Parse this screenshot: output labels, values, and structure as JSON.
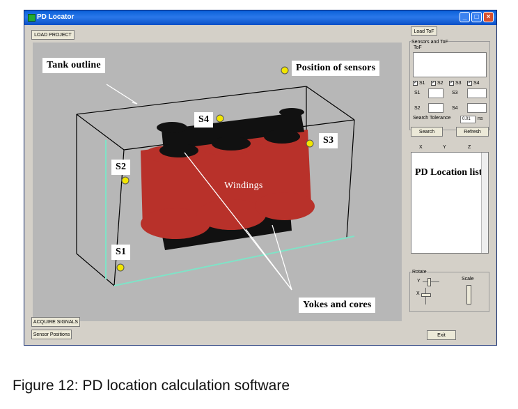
{
  "window": {
    "title": "PD Locator",
    "buttons": {
      "minimize": "_",
      "maximize": "□",
      "close": "×"
    }
  },
  "toolbar": {
    "load_project": "LOAD PROJECT"
  },
  "viewport": {
    "callouts": {
      "tank_outline": "Tank outline",
      "position_of_sensors": "Position of sensors",
      "windings": "Windings",
      "yokes_and_cores": "Yokes and cores",
      "s1": "S1",
      "s2": "S2",
      "s3": "S3",
      "s4": "S4"
    },
    "colors": {
      "background": "#b7b7b7",
      "windings": "#b8312a",
      "cores": "#111111",
      "sensor": "#f2e600",
      "tank_floor": "#7fe3c7"
    }
  },
  "bottom": {
    "acquire_signals": "ACQUIRE SIGNALS",
    "sensor_positions": "Sensor Positions",
    "exit": "Exit"
  },
  "side": {
    "load_tof": "Load ToF",
    "group_title": "Sensors and ToF",
    "tof_label": "ToF",
    "checks": [
      {
        "label": "S1",
        "checked": true
      },
      {
        "label": "S2",
        "checked": true
      },
      {
        "label": "S3",
        "checked": true
      },
      {
        "label": "S4",
        "checked": true
      }
    ],
    "field_labels": {
      "s1": "S1",
      "s2": "S2",
      "s3": "S3",
      "s4": "S4"
    },
    "search_tolerance": {
      "label": "Search Tolerance",
      "value": "0.01",
      "unit": "ns"
    },
    "search": "Search",
    "refresh": "Refresh",
    "columns": [
      "X",
      "Y",
      "Z"
    ],
    "list_title": "PD Location list",
    "rotate": {
      "title": "Rotate",
      "y": "Y",
      "x": "X"
    },
    "scale": "Scale"
  },
  "caption": "Figure 12: PD location calculation software"
}
